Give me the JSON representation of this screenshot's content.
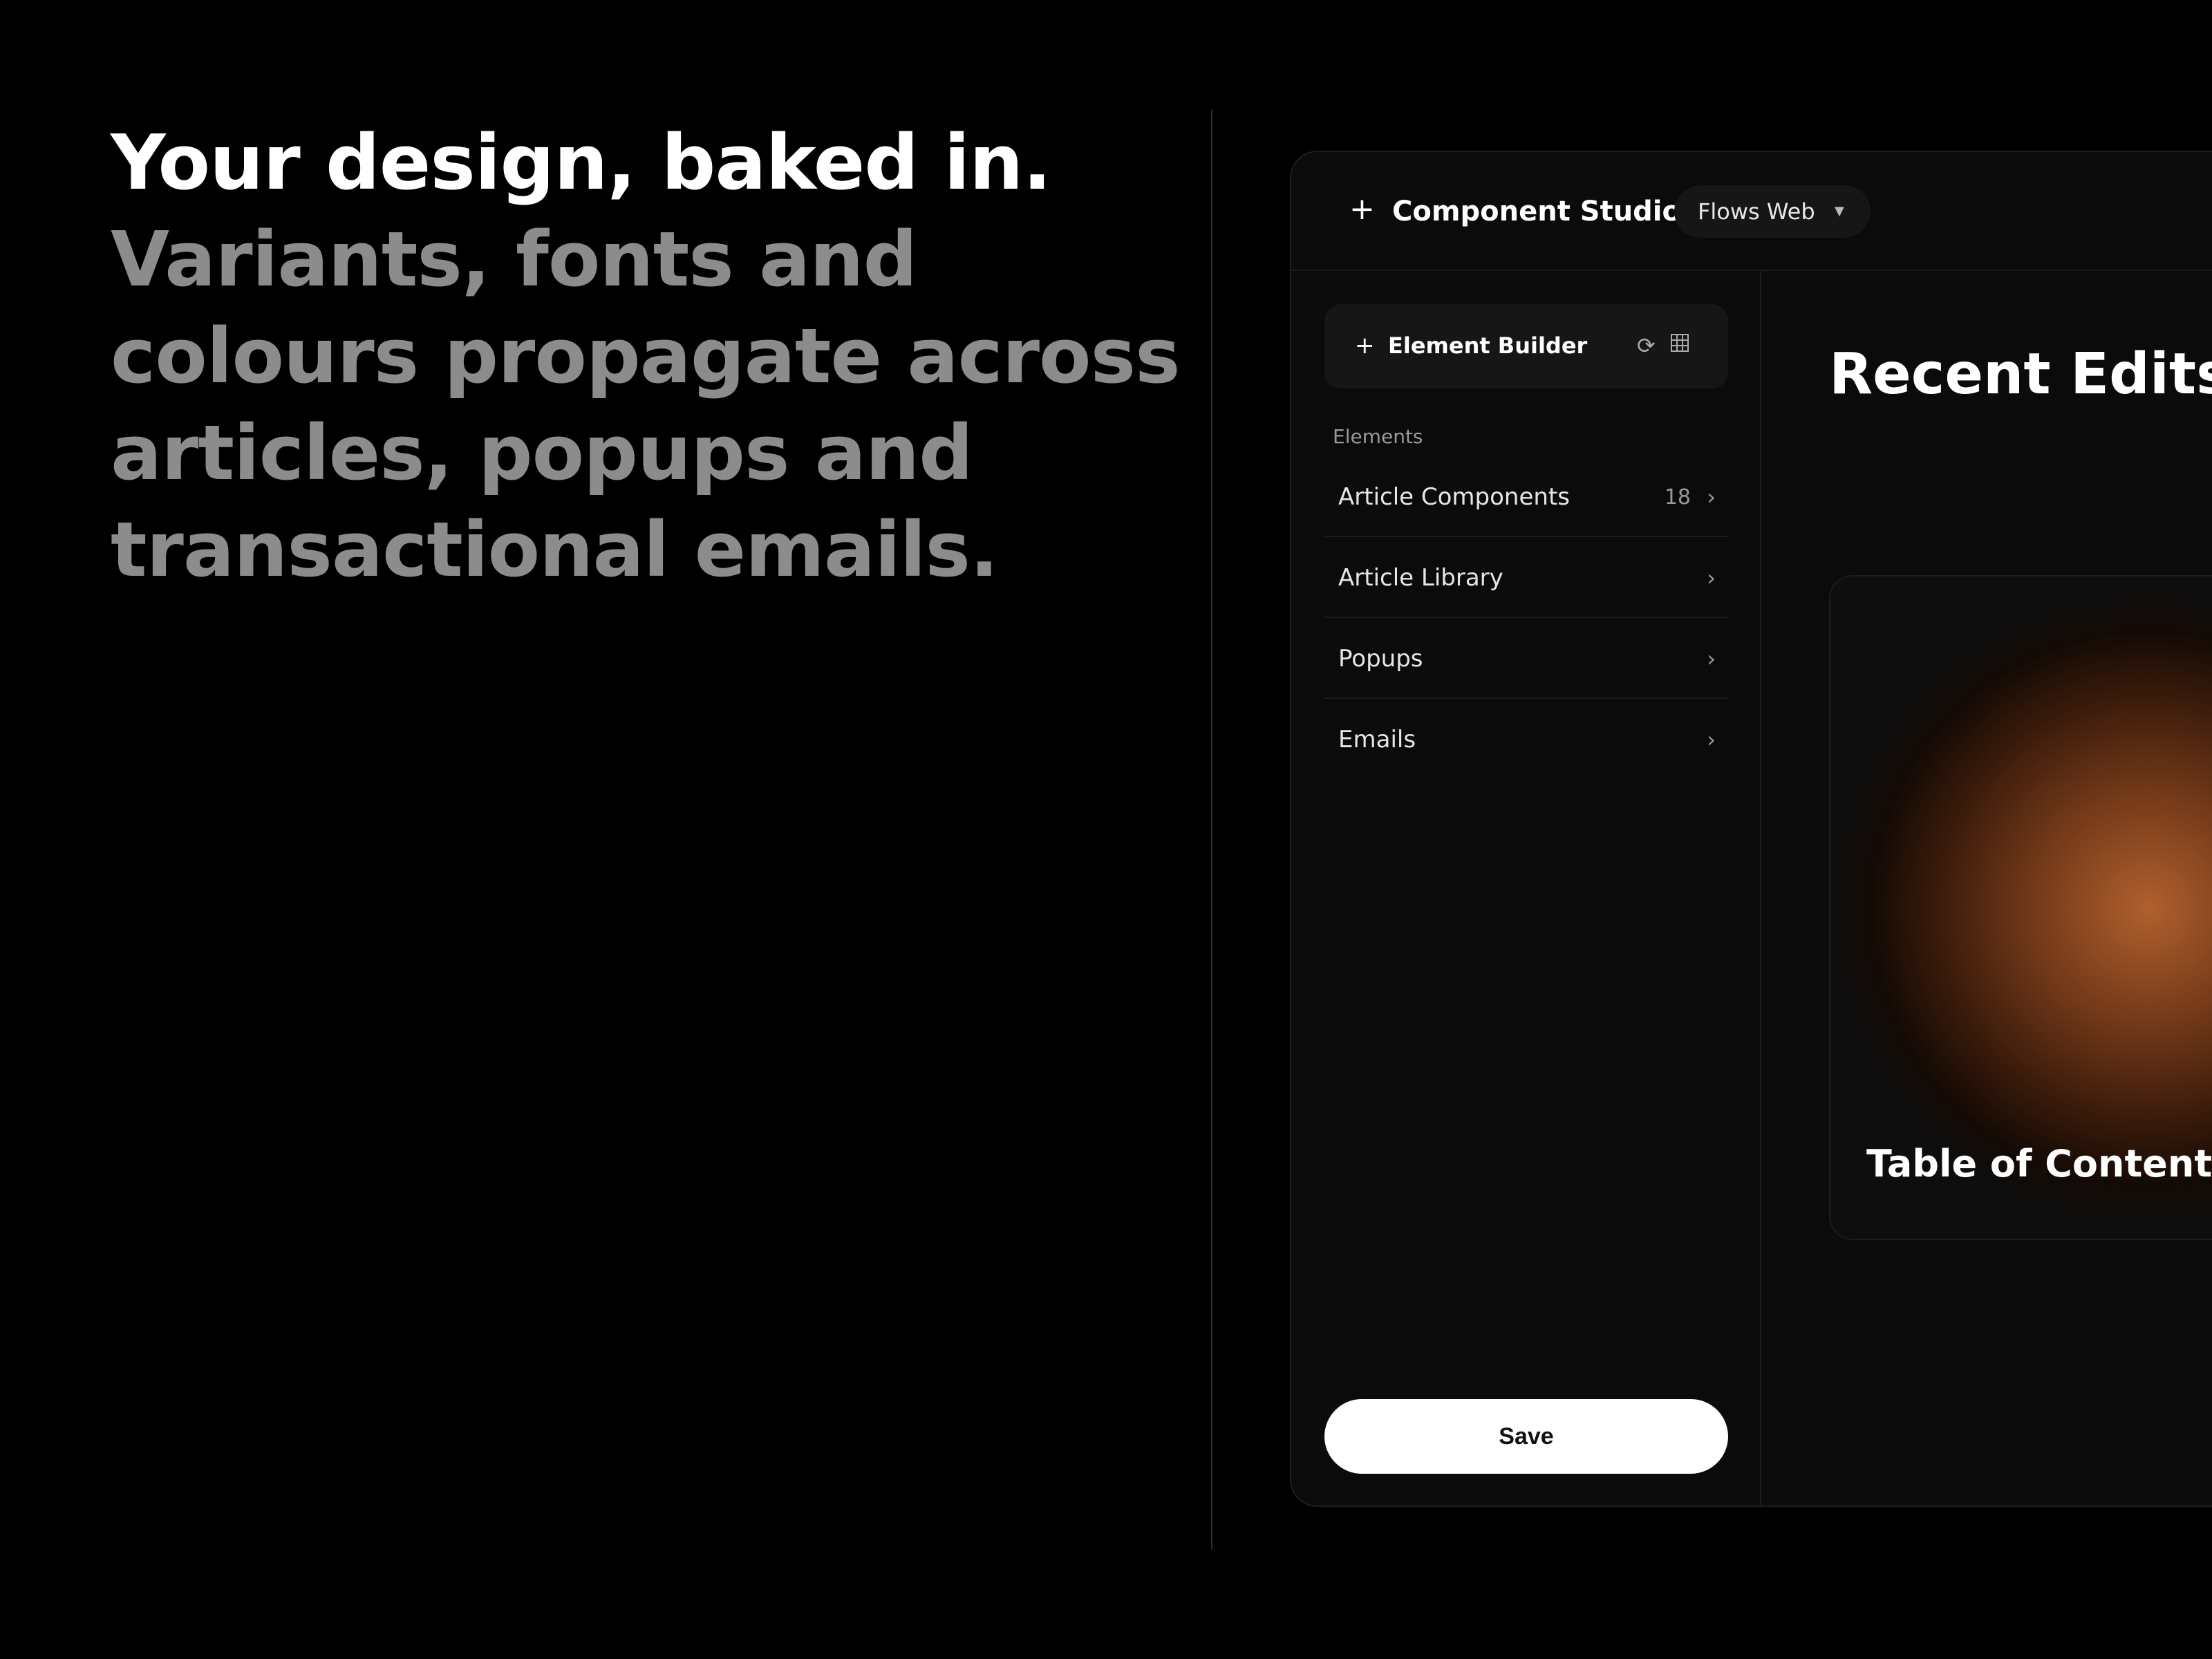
{
  "hero": {
    "headline": "Your design, baked in.",
    "subheadline": "Variants, fonts and colours propagate across articles, popups and transactional emails."
  },
  "app": {
    "title": "Component Studio",
    "project_selector": {
      "value": "Flows Web"
    },
    "sidebar": {
      "builder_label": "Element Builder",
      "section_label": "Elements",
      "items": [
        {
          "label": "Article Components",
          "count": "18"
        },
        {
          "label": "Article Library",
          "count": ""
        },
        {
          "label": "Popups",
          "count": ""
        },
        {
          "label": "Emails",
          "count": ""
        }
      ],
      "save_label": "Save"
    },
    "main": {
      "heading": "Recent Edits",
      "cards": [
        {
          "title": "Table of Contents"
        }
      ]
    }
  },
  "icons": {
    "add": "plus-icon",
    "refresh": "refresh-icon",
    "grid": "grid-icon",
    "dropdown": "caret-down-icon",
    "chevron": "chevron-right-icon"
  },
  "colors": {
    "background": "#000000",
    "panel": "#0b0b0b",
    "accent_glow": "#b0602e",
    "muted_text": "#8c8c8c"
  }
}
